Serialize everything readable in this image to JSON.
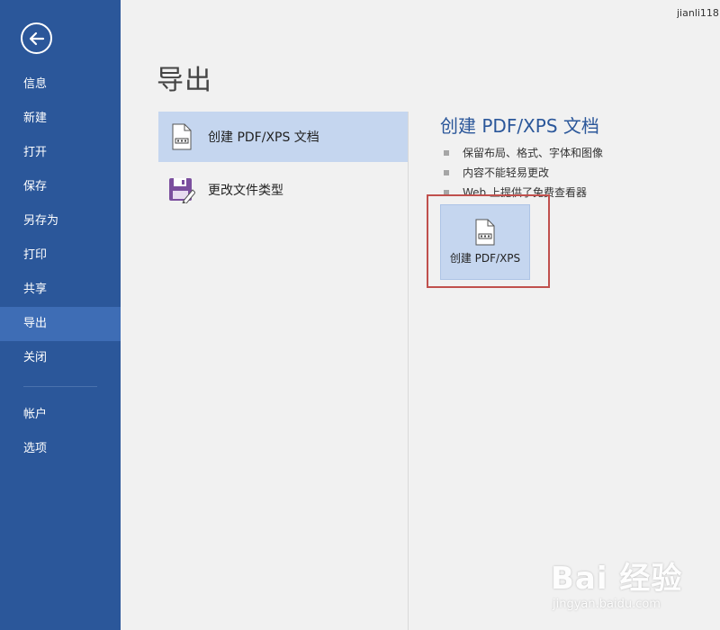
{
  "user": {
    "name": "jianli118"
  },
  "sidebar": {
    "back_icon": "back-arrow-icon",
    "items": [
      {
        "label": "信息"
      },
      {
        "label": "新建"
      },
      {
        "label": "打开"
      },
      {
        "label": "保存"
      },
      {
        "label": "另存为"
      },
      {
        "label": "打印"
      },
      {
        "label": "共享"
      },
      {
        "label": "导出",
        "active": true
      },
      {
        "label": "关闭"
      }
    ],
    "bottom_items": [
      {
        "label": "帐户"
      },
      {
        "label": "选项"
      }
    ]
  },
  "main": {
    "title": "导出",
    "options": [
      {
        "label": "创建 PDF/XPS 文档",
        "icon": "pdf-document-icon",
        "selected": true
      },
      {
        "label": "更改文件类型",
        "icon": "save-as-icon",
        "selected": false
      }
    ]
  },
  "detail": {
    "title": "创建 PDF/XPS 文档",
    "bullets": [
      "保留布局、格式、字体和图像",
      "内容不能轻易更改",
      "Web 上提供了免费查看器"
    ],
    "button_label": "创建 PDF/XPS"
  },
  "watermark": {
    "logo": "Bai 经验",
    "url": "jingyan.baidu.com"
  },
  "colors": {
    "sidebar_bg": "#2b579a",
    "sidebar_active": "#3e6db5",
    "selection": "#c5d6ef",
    "accent_text": "#2b579a",
    "highlight_border": "#c0504d"
  }
}
